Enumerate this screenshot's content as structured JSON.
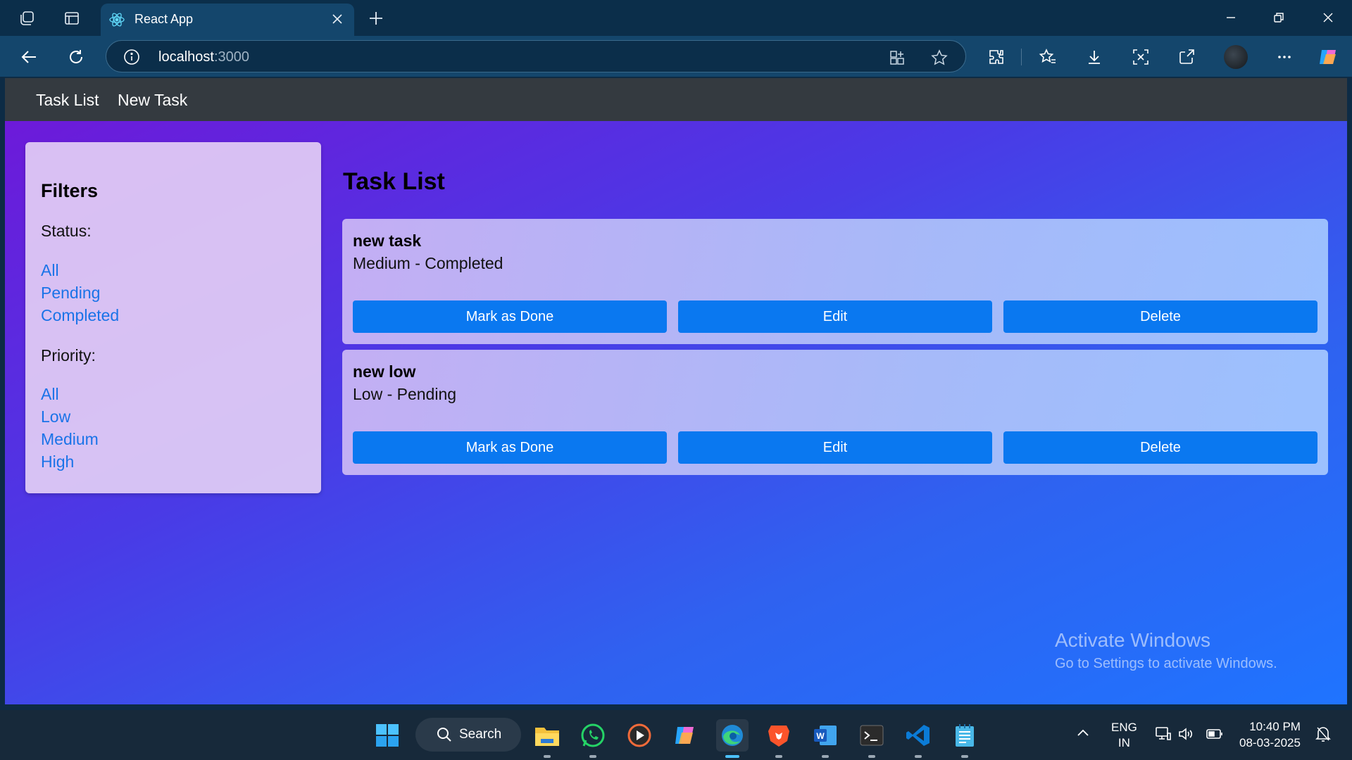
{
  "browser": {
    "tab_title": "React App",
    "url_host": "localhost",
    "url_port": ":3000"
  },
  "app": {
    "nav": [
      "Task List",
      "New Task"
    ],
    "filters": {
      "title": "Filters",
      "status_label": "Status:",
      "status_options": [
        "All",
        "Pending",
        "Completed"
      ],
      "priority_label": "Priority:",
      "priority_options": [
        "All",
        "Low",
        "Medium",
        "High"
      ]
    },
    "main_title": "Task List",
    "tasks": [
      {
        "name": "new task",
        "meta": "Medium - Completed"
      },
      {
        "name": "new low",
        "meta": "Low - Pending"
      }
    ],
    "buttons": {
      "done": "Mark as Done",
      "edit": "Edit",
      "delete": "Delete"
    }
  },
  "watermark": {
    "line1": "Activate Windows",
    "line2": "Go to Settings to activate Windows."
  },
  "taskbar": {
    "search_label": "Search",
    "lang_line1": "ENG",
    "lang_line2": "IN",
    "time": "10:40 PM",
    "date": "08-03-2025"
  },
  "colors": {
    "accent": "#0a78f0",
    "link": "#1a73e8",
    "nav_bg": "#343a40"
  }
}
